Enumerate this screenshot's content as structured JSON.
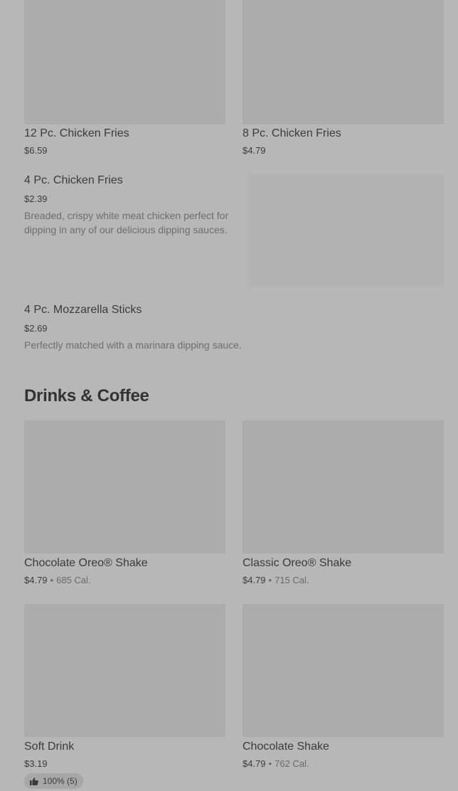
{
  "items": {
    "chicken_fries_12": {
      "name": "12 Pc. Chicken Fries",
      "price": "$6.59"
    },
    "chicken_fries_8": {
      "name": "8 Pc. Chicken Fries",
      "price": "$4.79"
    },
    "chicken_fries_4": {
      "name": "4 Pc. Chicken Fries",
      "price": "$2.39",
      "description": "Breaded, crispy white meat chicken perfect for dipping in any of our delicious dipping sauces."
    },
    "mozzarella_sticks": {
      "name": "4 Pc. Mozzarella Sticks",
      "price": "$2.69",
      "description": "Perfectly matched with a marinara dipping sauce."
    }
  },
  "drinks_section": {
    "title": "Drinks & Coffee",
    "items": [
      {
        "name": "Chocolate Oreo® Shake",
        "price": "$4.79",
        "separator": "•",
        "calories": "685 Cal."
      },
      {
        "name": "Classic Oreo® Shake",
        "price": "$4.79",
        "separator": "•",
        "calories": "715 Cal."
      },
      {
        "name": "Soft Drink",
        "price": "$3.19",
        "rating": {
          "text": "100% (5)",
          "icon": "thumbs-up-icon"
        }
      },
      {
        "name": "Chocolate Shake",
        "price": "$4.79",
        "separator": "•",
        "calories": "762 Cal."
      }
    ]
  }
}
